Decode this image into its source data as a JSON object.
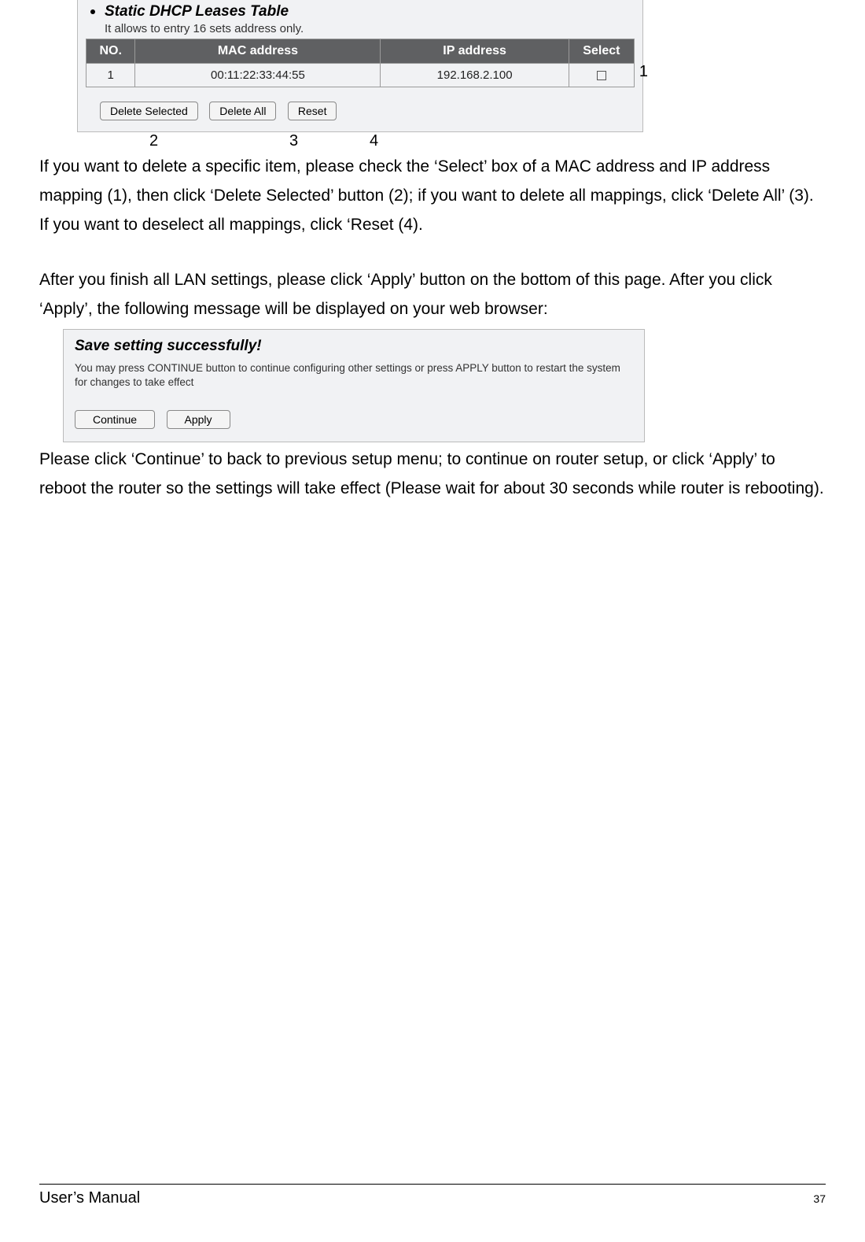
{
  "panel1": {
    "title": "Static DHCP Leases Table",
    "hint": "It allows to entry 16 sets address only.",
    "headers": {
      "no": "NO.",
      "mac": "MAC address",
      "ip": "IP address",
      "select": "Select"
    },
    "rows": [
      {
        "no": "1",
        "mac": "00:11:22:33:44:55",
        "ip": "192.168.2.100"
      }
    ],
    "buttons": {
      "deleteSelected": "Delete Selected",
      "deleteAll": "Delete All",
      "reset": "Reset"
    }
  },
  "annotations": {
    "a1": "1",
    "a2": "2",
    "a3": "3",
    "a4": "4"
  },
  "paragraphs": {
    "p1": "If you want to delete a specific item, please check the ‘Select’ box of a MAC address and IP address mapping (1), then click ‘Delete Selected’ button (2); if you want to delete all mappings, click ‘Delete All’ (3). If you want to deselect all mappings, click ‘Reset (4).",
    "p2": "After you finish all LAN settings, please click ‘Apply’ button on the bottom of this page. After you click ‘Apply’, the following message will be displayed on your web browser:",
    "p3": "Please click ‘Continue’ to back to previous setup menu; to continue on router setup, or click ‘Apply’ to reboot the router so the settings will take effect (Please wait for about 30 seconds while router is rebooting)."
  },
  "panel2": {
    "title": "Save setting successfully!",
    "msg": "You may press CONTINUE button to continue configuring other settings or press APPLY button to restart the system for changes to take effect",
    "buttons": {
      "continue": "Continue",
      "apply": "Apply"
    }
  },
  "footer": {
    "left": "User’s Manual",
    "page": "37"
  }
}
